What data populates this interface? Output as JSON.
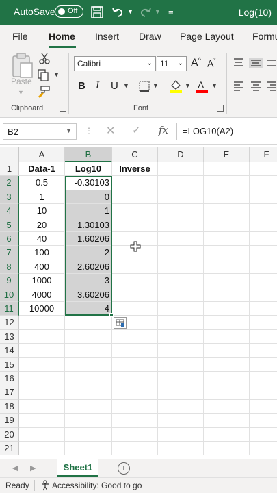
{
  "titlebar": {
    "autosave_label": "AutoSave",
    "toggle_state": "Off",
    "document_title": "Log(10)"
  },
  "tabs": [
    "File",
    "Home",
    "Insert",
    "Draw",
    "Page Layout",
    "Formu"
  ],
  "active_tab": "Home",
  "ribbon": {
    "paste_label": "Paste",
    "clipboard_label": "Clipboard",
    "font_name": "Calibri",
    "font_size": "11",
    "bold": "B",
    "italic": "I",
    "underline": "U",
    "font_label": "Font",
    "grow_font": "A",
    "shrink_font": "A",
    "colors": {
      "highlight": "#ffff00",
      "font_color": "#ff0000"
    }
  },
  "formula_bar": {
    "name_box": "B2",
    "formula": "=LOG10(A2)"
  },
  "grid": {
    "columns": [
      "A",
      "B",
      "C",
      "D",
      "E",
      "F"
    ],
    "selected_column": "B",
    "rows": [
      "1",
      "2",
      "3",
      "4",
      "5",
      "6",
      "7",
      "8",
      "9",
      "10",
      "11",
      "12",
      "13",
      "14",
      "15",
      "16",
      "17",
      "18",
      "19",
      "20",
      "21"
    ],
    "header_row": [
      "Data-1",
      "Log10",
      "Inverse"
    ],
    "data": [
      [
        "0.5",
        "-0.30103"
      ],
      [
        "1",
        "0"
      ],
      [
        "10",
        "1"
      ],
      [
        "20",
        "1.30103"
      ],
      [
        "40",
        "1.60206"
      ],
      [
        "100",
        "2"
      ],
      [
        "400",
        "2.60206"
      ],
      [
        "1000",
        "3"
      ],
      [
        "4000",
        "3.60206"
      ],
      [
        "10000",
        "4"
      ]
    ]
  },
  "sheets": {
    "active": "Sheet1"
  },
  "status": {
    "ready": "Ready",
    "accessibility": "Accessibility: Good to go"
  },
  "theme": {
    "accent": "#217346",
    "selection_fill": "#d3d3d3"
  }
}
